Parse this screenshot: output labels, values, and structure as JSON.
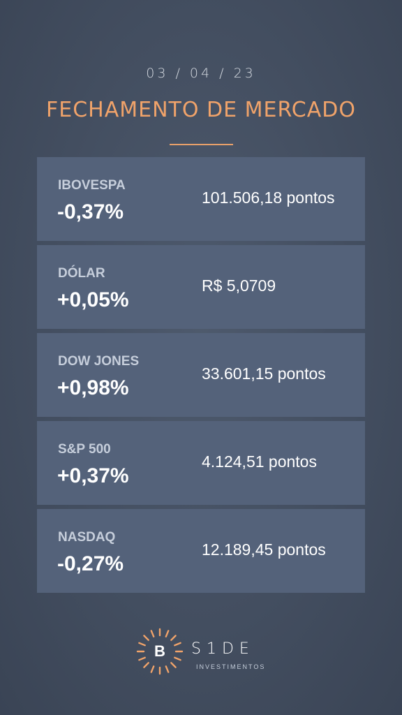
{
  "header": {
    "date": "03 / 04 / 23",
    "title": "FECHAMENTO DE MERCADO"
  },
  "markets": [
    {
      "name": "IBOVESPA",
      "change": "-0,37%",
      "value": "101.506,18 pontos"
    },
    {
      "name": "DÓLAR",
      "change": "+0,05%",
      "value": "R$ 5,0709"
    },
    {
      "name": "DOW JONES",
      "change": "+0,98%",
      "value": "33.601,15 pontos"
    },
    {
      "name": "S&P 500",
      "change": "+0,37%",
      "value": "4.124,51 pontos"
    },
    {
      "name": "NASDAQ",
      "change": "-0,27%",
      "value": "12.189,45 pontos"
    }
  ],
  "brand": {
    "mark_letter": "B",
    "word": "S1DE",
    "subtitle": "INVESTIMENTOS"
  },
  "colors": {
    "accent": "#f0a36a",
    "card_bg": "#54627a",
    "background": "#434e60"
  }
}
